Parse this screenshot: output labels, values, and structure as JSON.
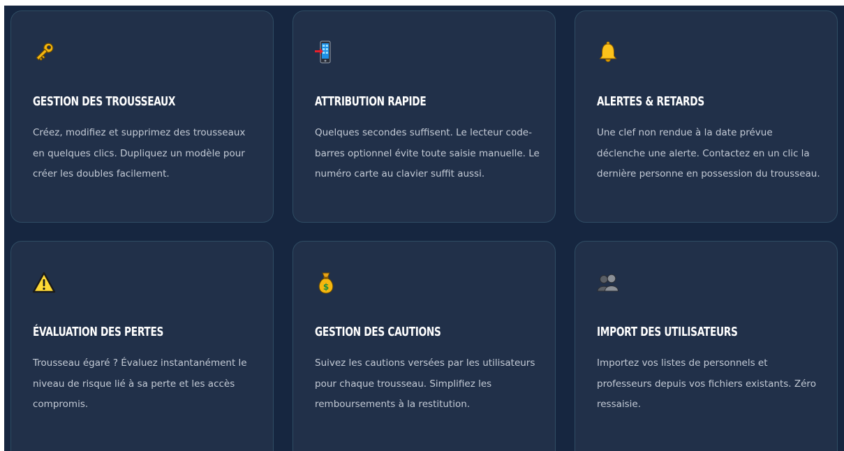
{
  "features": [
    {
      "icon": "key-icon",
      "title": "GESTION DES TROUSSEAUX",
      "description": "Créez, modifiez et supprimez des trousseaux en quelques clics. Dupliquez un modèle pour créer les doubles facilement."
    },
    {
      "icon": "mobile-phone-arrow-icon",
      "title": "ATTRIBUTION RAPIDE",
      "description": "Quelques secondes suffisent. Le lecteur code-barres optionnel évite toute saisie manuelle. Le numéro carte au clavier suffit aussi."
    },
    {
      "icon": "bell-icon",
      "title": "ALERTES & RETARDS",
      "description": "Une clef non rendue à la date prévue déclenche une alerte. Contactez en un clic la dernière personne en possession du trousseau."
    },
    {
      "icon": "warning-icon",
      "title": "ÉVALUATION DES PERTES",
      "description": "Trousseau égaré ? Évaluez instantanément le niveau de risque lié à sa perte et les accès compromis."
    },
    {
      "icon": "money-bag-icon",
      "title": "GESTION DES CAUTIONS",
      "description": "Suivez les cautions versées par les utilisateurs pour chaque trousseau. Simplifiez les remboursements à la restitution."
    },
    {
      "icon": "users-silhouette-icon",
      "title": "IMPORT DES UTILISATEURS",
      "description": "Importez vos listes de personnels et professeurs depuis vos fichiers existants. Zéro ressaisie."
    }
  ],
  "colors": {
    "page_background": "#162640",
    "card_background": "#213049",
    "card_border": "#2f4c63",
    "title": "#ffffff",
    "text": "#c4cbd6",
    "icon_gold": "#f5b70f"
  }
}
